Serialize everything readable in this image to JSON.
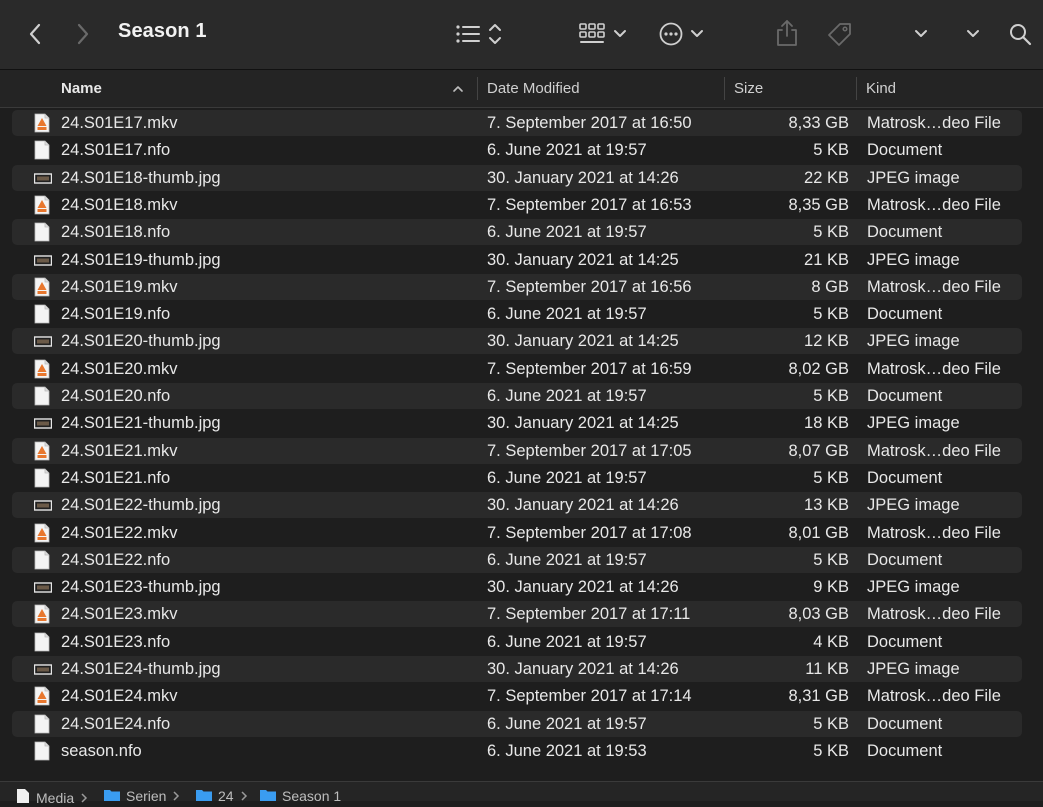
{
  "window": {
    "title": "Season 1"
  },
  "toolbar": {
    "back_icon": "chevron-left-icon",
    "forward_icon": "chevron-right-icon",
    "view_list_icon": "list-view-icon",
    "view_grid_icon": "grid-view-icon",
    "action_icon": "ellipsis-circle-icon",
    "share_icon": "share-icon",
    "tag_icon": "tag-icon",
    "search_icon": "search-icon"
  },
  "columns": {
    "name": "Name",
    "date": "Date Modified",
    "size": "Size",
    "kind": "Kind"
  },
  "files": [
    {
      "name": "24.S01E17.mkv",
      "date": "7. September 2017 at 16:50",
      "size": "8,33 GB",
      "kind": "Matrosk…deo File",
      "type": "mkv"
    },
    {
      "name": "24.S01E17.nfo",
      "date": "6. June 2021 at 19:57",
      "size": "5 KB",
      "kind": "Document",
      "type": "doc"
    },
    {
      "name": "24.S01E18-thumb.jpg",
      "date": "30. January 2021 at 14:26",
      "size": "22 KB",
      "kind": "JPEG image",
      "type": "jpg"
    },
    {
      "name": "24.S01E18.mkv",
      "date": "7. September 2017 at 16:53",
      "size": "8,35 GB",
      "kind": "Matrosk…deo File",
      "type": "mkv"
    },
    {
      "name": "24.S01E18.nfo",
      "date": "6. June 2021 at 19:57",
      "size": "5 KB",
      "kind": "Document",
      "type": "doc"
    },
    {
      "name": "24.S01E19-thumb.jpg",
      "date": "30. January 2021 at 14:25",
      "size": "21 KB",
      "kind": "JPEG image",
      "type": "jpg"
    },
    {
      "name": "24.S01E19.mkv",
      "date": "7. September 2017 at 16:56",
      "size": "8 GB",
      "kind": "Matrosk…deo File",
      "type": "mkv"
    },
    {
      "name": "24.S01E19.nfo",
      "date": "6. June 2021 at 19:57",
      "size": "5 KB",
      "kind": "Document",
      "type": "doc"
    },
    {
      "name": "24.S01E20-thumb.jpg",
      "date": "30. January 2021 at 14:25",
      "size": "12 KB",
      "kind": "JPEG image",
      "type": "jpg"
    },
    {
      "name": "24.S01E20.mkv",
      "date": "7. September 2017 at 16:59",
      "size": "8,02 GB",
      "kind": "Matrosk…deo File",
      "type": "mkv"
    },
    {
      "name": "24.S01E20.nfo",
      "date": "6. June 2021 at 19:57",
      "size": "5 KB",
      "kind": "Document",
      "type": "doc"
    },
    {
      "name": "24.S01E21-thumb.jpg",
      "date": "30. January 2021 at 14:25",
      "size": "18 KB",
      "kind": "JPEG image",
      "type": "jpg"
    },
    {
      "name": "24.S01E21.mkv",
      "date": "7. September 2017 at 17:05",
      "size": "8,07 GB",
      "kind": "Matrosk…deo File",
      "type": "mkv"
    },
    {
      "name": "24.S01E21.nfo",
      "date": "6. June 2021 at 19:57",
      "size": "5 KB",
      "kind": "Document",
      "type": "doc"
    },
    {
      "name": "24.S01E22-thumb.jpg",
      "date": "30. January 2021 at 14:26",
      "size": "13 KB",
      "kind": "JPEG image",
      "type": "jpg"
    },
    {
      "name": "24.S01E22.mkv",
      "date": "7. September 2017 at 17:08",
      "size": "8,01 GB",
      "kind": "Matrosk…deo File",
      "type": "mkv"
    },
    {
      "name": "24.S01E22.nfo",
      "date": "6. June 2021 at 19:57",
      "size": "5 KB",
      "kind": "Document",
      "type": "doc"
    },
    {
      "name": "24.S01E23-thumb.jpg",
      "date": "30. January 2021 at 14:26",
      "size": "9 KB",
      "kind": "JPEG image",
      "type": "jpg"
    },
    {
      "name": "24.S01E23.mkv",
      "date": "7. September 2017 at 17:11",
      "size": "8,03 GB",
      "kind": "Matrosk…deo File",
      "type": "mkv"
    },
    {
      "name": "24.S01E23.nfo",
      "date": "6. June 2021 at 19:57",
      "size": "4 KB",
      "kind": "Document",
      "type": "doc"
    },
    {
      "name": "24.S01E24-thumb.jpg",
      "date": "30. January 2021 at 14:26",
      "size": "11 KB",
      "kind": "JPEG image",
      "type": "jpg"
    },
    {
      "name": "24.S01E24.mkv",
      "date": "7. September 2017 at 17:14",
      "size": "8,31 GB",
      "kind": "Matrosk…deo File",
      "type": "mkv"
    },
    {
      "name": "24.S01E24.nfo",
      "date": "6. June 2021 at 19:57",
      "size": "5 KB",
      "kind": "Document",
      "type": "doc"
    },
    {
      "name": "season.nfo",
      "date": "6. June 2021 at 19:53",
      "size": "5 KB",
      "kind": "Document",
      "type": "doc"
    }
  ],
  "pathbar": {
    "items": [
      {
        "label": "Media",
        "icon": "drive-icon"
      },
      {
        "label": "Serien",
        "icon": "folder-icon"
      },
      {
        "label": "24",
        "icon": "folder-icon"
      },
      {
        "label": "Season 1",
        "icon": "folder-icon"
      }
    ]
  },
  "colors": {
    "accent_folder": "#3a9cf0",
    "mkv_orange": "#e8772e"
  }
}
